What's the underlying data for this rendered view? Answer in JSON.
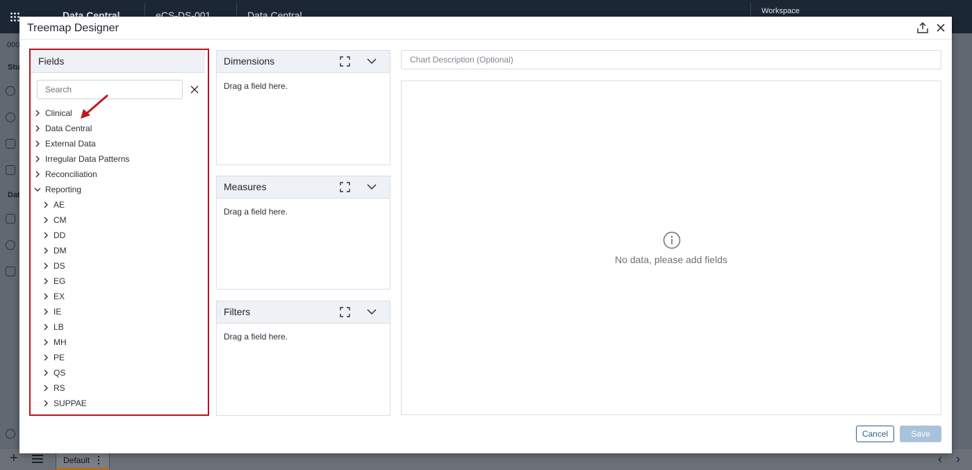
{
  "background": {
    "app_title": "Data Central",
    "study_dropdown": "eCS-DS-001",
    "module_dropdown": "Data Central",
    "workspace_label": "Workspace",
    "sidebar_labels": [
      "000",
      "Stu",
      "Dat"
    ],
    "bottom_tab_label": "Default"
  },
  "modal": {
    "title": "Treemap Designer",
    "fields_panel": {
      "title": "Fields",
      "search_placeholder": "Search",
      "tree": [
        {
          "label": "Clinical",
          "level": 0,
          "expanded": false
        },
        {
          "label": "Data Central",
          "level": 0,
          "expanded": false
        },
        {
          "label": "External Data",
          "level": 0,
          "expanded": false
        },
        {
          "label": "Irregular Data Patterns",
          "level": 0,
          "expanded": false
        },
        {
          "label": "Reconciliation",
          "level": 0,
          "expanded": false
        },
        {
          "label": "Reporting",
          "level": 0,
          "expanded": true
        },
        {
          "label": "AE",
          "level": 1,
          "expanded": false
        },
        {
          "label": "CM",
          "level": 1,
          "expanded": false
        },
        {
          "label": "DD",
          "level": 1,
          "expanded": false
        },
        {
          "label": "DM",
          "level": 1,
          "expanded": false
        },
        {
          "label": "DS",
          "level": 1,
          "expanded": false
        },
        {
          "label": "EG",
          "level": 1,
          "expanded": false
        },
        {
          "label": "EX",
          "level": 1,
          "expanded": false
        },
        {
          "label": "IE",
          "level": 1,
          "expanded": false
        },
        {
          "label": "LB",
          "level": 1,
          "expanded": false
        },
        {
          "label": "MH",
          "level": 1,
          "expanded": false
        },
        {
          "label": "PE",
          "level": 1,
          "expanded": false
        },
        {
          "label": "QS",
          "level": 1,
          "expanded": false
        },
        {
          "label": "RS",
          "level": 1,
          "expanded": false
        },
        {
          "label": "SUPPAE",
          "level": 1,
          "expanded": false
        }
      ]
    },
    "dimensions": {
      "title": "Dimensions",
      "hint": "Drag a field here."
    },
    "measures": {
      "title": "Measures",
      "hint": "Drag a field here."
    },
    "filters": {
      "title": "Filters",
      "hint": "Drag a field here."
    },
    "chart_description_placeholder": "Chart Description (Optional)",
    "empty_state_message": "No data, please add fields",
    "cancel_label": "Cancel",
    "save_label": "Save"
  },
  "colors": {
    "highlight_border": "#b7131f",
    "annotation_arrow": "#c0171e",
    "primary": "#2c5e8f",
    "disabled_button": "#a9c2db",
    "topbar": "#1c2735"
  }
}
